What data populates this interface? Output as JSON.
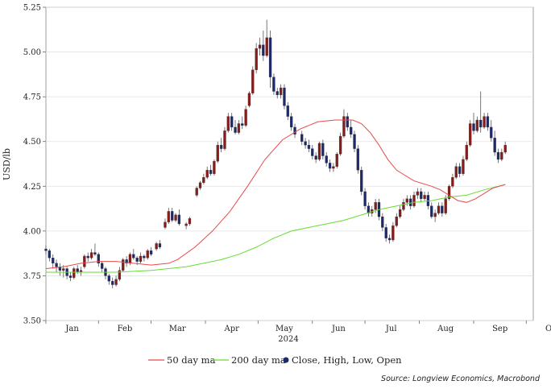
{
  "chart_data": {
    "type": "candlestick",
    "title": "",
    "ylabel": "USD/lb",
    "xlabel": "2024",
    "ylim": [
      3.5,
      5.25
    ],
    "yticks": [
      "3.50",
      "3.75",
      "4.00",
      "4.25",
      "4.50",
      "4.75",
      "5.00",
      "5.25"
    ],
    "x_range_days": [
      0,
      278
    ],
    "months": [
      {
        "label": "Jan",
        "day": 15
      },
      {
        "label": "Feb",
        "day": 45
      },
      {
        "label": "Mar",
        "day": 75
      },
      {
        "label": "Apr",
        "day": 106
      },
      {
        "label": "May",
        "day": 136
      },
      {
        "label": "Jun",
        "day": 167
      },
      {
        "label": "Jul",
        "day": 197
      },
      {
        "label": "Aug",
        "day": 228
      },
      {
        "label": "Sep",
        "day": 259
      },
      {
        "label": "Oct",
        "day": 289
      }
    ],
    "candles": [
      [
        0,
        3.9,
        3.92,
        3.87,
        3.89
      ],
      [
        2,
        3.89,
        3.9,
        3.83,
        3.85
      ],
      [
        4,
        3.85,
        3.87,
        3.79,
        3.82
      ],
      [
        6,
        3.82,
        3.84,
        3.77,
        3.8
      ],
      [
        8,
        3.8,
        3.82,
        3.75,
        3.78
      ],
      [
        10,
        3.78,
        3.81,
        3.74,
        3.79
      ],
      [
        12,
        3.79,
        3.8,
        3.73,
        3.75
      ],
      [
        14,
        3.75,
        3.77,
        3.72,
        3.74
      ],
      [
        16,
        3.74,
        3.8,
        3.73,
        3.79
      ],
      [
        18,
        3.79,
        3.81,
        3.76,
        3.77
      ],
      [
        20,
        3.77,
        3.8,
        3.75,
        3.78
      ],
      [
        22,
        3.8,
        3.87,
        3.79,
        3.86
      ],
      [
        24,
        3.86,
        3.88,
        3.83,
        3.85
      ],
      [
        26,
        3.85,
        3.9,
        3.84,
        3.88
      ],
      [
        28,
        3.88,
        3.93,
        3.86,
        3.87
      ],
      [
        30,
        3.87,
        3.88,
        3.8,
        3.82
      ],
      [
        32,
        3.82,
        3.83,
        3.77,
        3.79
      ],
      [
        34,
        3.79,
        3.8,
        3.73,
        3.75
      ],
      [
        36,
        3.75,
        3.76,
        3.7,
        3.72
      ],
      [
        38,
        3.72,
        3.74,
        3.68,
        3.7
      ],
      [
        40,
        3.7,
        3.75,
        3.69,
        3.73
      ],
      [
        42,
        3.73,
        3.8,
        3.72,
        3.78
      ],
      [
        44,
        3.78,
        3.85,
        3.77,
        3.84
      ],
      [
        46,
        3.84,
        3.86,
        3.8,
        3.82
      ],
      [
        48,
        3.82,
        3.88,
        3.81,
        3.87
      ],
      [
        50,
        3.87,
        3.9,
        3.84,
        3.85
      ],
      [
        52,
        3.85,
        3.86,
        3.81,
        3.83
      ],
      [
        54,
        3.83,
        3.88,
        3.82,
        3.86
      ],
      [
        56,
        3.86,
        3.87,
        3.83,
        3.85
      ],
      [
        58,
        3.85,
        3.9,
        3.84,
        3.89
      ],
      [
        60,
        3.89,
        3.91,
        3.86,
        3.87
      ],
      [
        63,
        3.9,
        3.94,
        3.89,
        3.93
      ],
      [
        65,
        3.93,
        3.95,
        3.9,
        3.91
      ],
      [
        68,
        4.02,
        4.07,
        4.01,
        4.05
      ],
      [
        70,
        4.05,
        4.13,
        4.04,
        4.11
      ],
      [
        72,
        4.11,
        4.13,
        4.05,
        4.06
      ],
      [
        74,
        4.06,
        4.1,
        4.05,
        4.09
      ],
      [
        76,
        4.09,
        4.12,
        4.03,
        4.04
      ],
      [
        80,
        4.03,
        4.05,
        4.01,
        4.04
      ],
      [
        82,
        4.04,
        4.08,
        4.03,
        4.07
      ],
      [
        86,
        4.2,
        4.25,
        4.19,
        4.24
      ],
      [
        88,
        4.24,
        4.28,
        4.23,
        4.27
      ],
      [
        90,
        4.27,
        4.32,
        4.26,
        4.3
      ],
      [
        92,
        4.3,
        4.36,
        4.29,
        4.34
      ],
      [
        94,
        4.34,
        4.37,
        4.31,
        4.32
      ],
      [
        96,
        4.32,
        4.4,
        4.31,
        4.39
      ],
      [
        98,
        4.39,
        4.5,
        4.38,
        4.48
      ],
      [
        100,
        4.48,
        4.52,
        4.44,
        4.46
      ],
      [
        102,
        4.46,
        4.58,
        4.45,
        4.56
      ],
      [
        104,
        4.56,
        4.66,
        4.55,
        4.64
      ],
      [
        106,
        4.64,
        4.66,
        4.56,
        4.58
      ],
      [
        108,
        4.58,
        4.62,
        4.54,
        4.55
      ],
      [
        110,
        4.55,
        4.62,
        4.54,
        4.6
      ],
      [
        112,
        4.6,
        4.64,
        4.57,
        4.59
      ],
      [
        114,
        4.59,
        4.7,
        4.58,
        4.68
      ],
      [
        116,
        4.7,
        4.78,
        4.69,
        4.77
      ],
      [
        118,
        4.77,
        4.92,
        4.76,
        4.9
      ],
      [
        120,
        4.9,
        5.05,
        4.88,
        5.02
      ],
      [
        122,
        5.02,
        5.08,
        4.98,
        5.04
      ],
      [
        124,
        5.04,
        5.12,
        4.95,
        4.98
      ],
      [
        126,
        4.98,
        5.18,
        4.97,
        5.08
      ],
      [
        128,
        5.08,
        5.12,
        4.8,
        4.86
      ],
      [
        130,
        4.86,
        4.88,
        4.76,
        4.78
      ],
      [
        132,
        4.78,
        4.8,
        4.74,
        4.76
      ],
      [
        134,
        4.76,
        4.82,
        4.74,
        4.8
      ],
      [
        136,
        4.8,
        4.82,
        4.68,
        4.7
      ],
      [
        138,
        4.7,
        4.72,
        4.62,
        4.64
      ],
      [
        140,
        4.64,
        4.66,
        4.56,
        4.58
      ],
      [
        142,
        4.58,
        4.6,
        4.52,
        4.54
      ],
      [
        146,
        4.54,
        4.56,
        4.48,
        4.5
      ],
      [
        148,
        4.5,
        4.52,
        4.46,
        4.48
      ],
      [
        150,
        4.48,
        4.51,
        4.44,
        4.46
      ],
      [
        152,
        4.46,
        4.48,
        4.4,
        4.42
      ],
      [
        154,
        4.42,
        4.44,
        4.38,
        4.4
      ],
      [
        156,
        4.4,
        4.5,
        4.39,
        4.49
      ],
      [
        158,
        4.49,
        4.51,
        4.4,
        4.42
      ],
      [
        160,
        4.42,
        4.44,
        4.36,
        4.38
      ],
      [
        162,
        4.38,
        4.4,
        4.33,
        4.35
      ],
      [
        164,
        4.35,
        4.38,
        4.33,
        4.36
      ],
      [
        166,
        4.36,
        4.44,
        4.35,
        4.43
      ],
      [
        168,
        4.43,
        4.55,
        4.42,
        4.53
      ],
      [
        170,
        4.53,
        4.68,
        4.52,
        4.64
      ],
      [
        172,
        4.64,
        4.66,
        4.56,
        4.58
      ],
      [
        174,
        4.58,
        4.62,
        4.52,
        4.54
      ],
      [
        176,
        4.54,
        4.56,
        4.44,
        4.46
      ],
      [
        178,
        4.46,
        4.48,
        4.32,
        4.34
      ],
      [
        180,
        4.34,
        4.36,
        4.2,
        4.22
      ],
      [
        182,
        4.22,
        4.24,
        4.12,
        4.14
      ],
      [
        184,
        4.14,
        4.16,
        4.08,
        4.1
      ],
      [
        186,
        4.1,
        4.14,
        4.08,
        4.12
      ],
      [
        188,
        4.12,
        4.18,
        4.1,
        4.16
      ],
      [
        190,
        4.16,
        4.18,
        4.06,
        4.08
      ],
      [
        192,
        4.08,
        4.1,
        4.0,
        4.02
      ],
      [
        194,
        4.02,
        4.04,
        3.94,
        3.96
      ],
      [
        196,
        3.96,
        3.98,
        3.93,
        3.95
      ],
      [
        198,
        3.95,
        4.05,
        3.94,
        4.03
      ],
      [
        200,
        4.03,
        4.1,
        4.02,
        4.08
      ],
      [
        202,
        4.08,
        4.14,
        4.07,
        4.12
      ],
      [
        204,
        4.12,
        4.18,
        4.11,
        4.16
      ],
      [
        206,
        4.16,
        4.2,
        4.14,
        4.18
      ],
      [
        208,
        4.18,
        4.2,
        4.12,
        4.14
      ],
      [
        210,
        4.14,
        4.22,
        4.13,
        4.2
      ],
      [
        212,
        4.2,
        4.24,
        4.18,
        4.22
      ],
      [
        214,
        4.22,
        4.24,
        4.16,
        4.18
      ],
      [
        216,
        4.18,
        4.22,
        4.17,
        4.2
      ],
      [
        218,
        4.2,
        4.22,
        4.12,
        4.14
      ],
      [
        220,
        4.14,
        4.16,
        4.07,
        4.08
      ],
      [
        222,
        4.08,
        4.12,
        4.05,
        4.1
      ],
      [
        224,
        4.1,
        4.16,
        4.09,
        4.14
      ],
      [
        226,
        4.14,
        4.16,
        4.08,
        4.1
      ],
      [
        228,
        4.1,
        4.2,
        4.09,
        4.18
      ],
      [
        230,
        4.18,
        4.26,
        4.17,
        4.25
      ],
      [
        232,
        4.25,
        4.32,
        4.24,
        4.3
      ],
      [
        234,
        4.3,
        4.38,
        4.29,
        4.36
      ],
      [
        236,
        4.36,
        4.38,
        4.3,
        4.32
      ],
      [
        238,
        4.32,
        4.42,
        4.31,
        4.4
      ],
      [
        240,
        4.4,
        4.5,
        4.39,
        4.48
      ],
      [
        242,
        4.48,
        4.62,
        4.47,
        4.6
      ],
      [
        244,
        4.6,
        4.66,
        4.54,
        4.56
      ],
      [
        246,
        4.56,
        4.64,
        4.55,
        4.62
      ],
      [
        248,
        4.62,
        4.78,
        4.55,
        4.58
      ],
      [
        250,
        4.58,
        4.66,
        4.57,
        4.64
      ],
      [
        252,
        4.64,
        4.66,
        4.56,
        4.58
      ],
      [
        254,
        4.58,
        4.62,
        4.5,
        4.52
      ],
      [
        256,
        4.52,
        4.56,
        4.42,
        4.44
      ],
      [
        258,
        4.44,
        4.46,
        4.38,
        4.4
      ],
      [
        260,
        4.4,
        4.46,
        4.39,
        4.44
      ],
      [
        262,
        4.44,
        4.5,
        4.43,
        4.48
      ]
    ],
    "ma50": [
      [
        0,
        3.79
      ],
      [
        10,
        3.8
      ],
      [
        20,
        3.82
      ],
      [
        30,
        3.83
      ],
      [
        40,
        3.83
      ],
      [
        50,
        3.82
      ],
      [
        60,
        3.81
      ],
      [
        70,
        3.82
      ],
      [
        75,
        3.84
      ],
      [
        85,
        3.91
      ],
      [
        95,
        4.0
      ],
      [
        105,
        4.11
      ],
      [
        115,
        4.25
      ],
      [
        125,
        4.4
      ],
      [
        135,
        4.51
      ],
      [
        145,
        4.57
      ],
      [
        155,
        4.61
      ],
      [
        165,
        4.62
      ],
      [
        175,
        4.62
      ],
      [
        180,
        4.6
      ],
      [
        185,
        4.55
      ],
      [
        190,
        4.48
      ],
      [
        195,
        4.4
      ],
      [
        200,
        4.34
      ],
      [
        210,
        4.28
      ],
      [
        220,
        4.25
      ],
      [
        225,
        4.23
      ],
      [
        230,
        4.2
      ],
      [
        235,
        4.17
      ],
      [
        240,
        4.16
      ],
      [
        245,
        4.18
      ],
      [
        250,
        4.21
      ],
      [
        255,
        4.24
      ],
      [
        262,
        4.26
      ]
    ],
    "ma200": [
      [
        0,
        3.77
      ],
      [
        20,
        3.77
      ],
      [
        40,
        3.77
      ],
      [
        60,
        3.78
      ],
      [
        80,
        3.8
      ],
      [
        100,
        3.84
      ],
      [
        110,
        3.87
      ],
      [
        120,
        3.91
      ],
      [
        130,
        3.96
      ],
      [
        140,
        4.0
      ],
      [
        150,
        4.02
      ],
      [
        160,
        4.04
      ],
      [
        170,
        4.06
      ],
      [
        180,
        4.09
      ],
      [
        190,
        4.12
      ],
      [
        200,
        4.14
      ],
      [
        210,
        4.16
      ],
      [
        220,
        4.17
      ],
      [
        230,
        4.19
      ],
      [
        240,
        4.2
      ],
      [
        250,
        4.23
      ],
      [
        262,
        4.26
      ]
    ],
    "colors": {
      "up": "#8b1a1a",
      "down": "#1c2a6b",
      "wick": "#555555",
      "ma50": "#e84a4a",
      "ma200": "#66dd33"
    },
    "legend": [
      {
        "label": "50 day ma",
        "type": "line",
        "color": "#e84a4a"
      },
      {
        "label": "200 day ma",
        "type": "line",
        "color": "#66dd33"
      },
      {
        "label": "Close, High, Low, Open",
        "type": "marker",
        "color": "#1c2a6b"
      }
    ],
    "source": "Source: Longview Economics, Macrobond"
  }
}
